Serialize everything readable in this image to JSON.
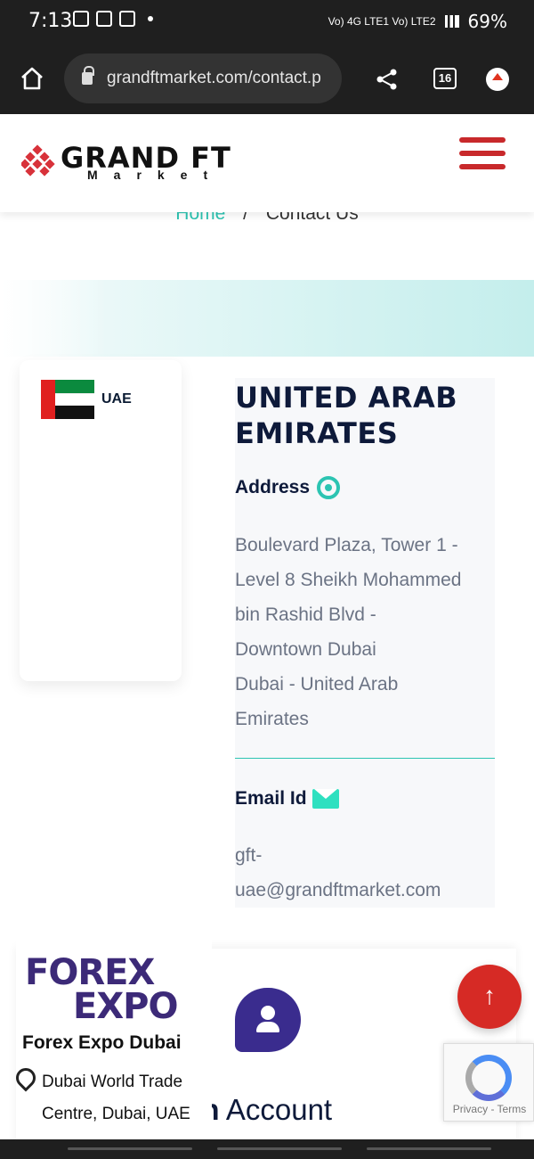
{
  "status_bar": {
    "time": "7:13",
    "network": "Vo) 4G LTE1 Vo) LTE2",
    "battery": "69%"
  },
  "browser": {
    "url": "grandftmarket.com/contact.p",
    "tab_count": "16"
  },
  "site": {
    "logo_name": "GRAND FT",
    "logo_sub": "Market",
    "brand_color": "#c8292b"
  },
  "breadcrumb": {
    "home": "Home",
    "separator": "/",
    "current": "Contact Us"
  },
  "sidebar": {
    "country": "UAE"
  },
  "office": {
    "title": "UNITED ARAB EMIRATES",
    "address_label": "Address",
    "address_lines": [
      "Boulevard Plaza, Tower 1 -",
      "Level 8 Sheikh Mohammed",
      "bin Rashid Blvd -",
      "Downtown Dubai",
      "Dubai - United Arab",
      "Emirates"
    ],
    "email_label": "Email Id",
    "email_lines": [
      "gft-",
      "uae@grandftmarket.com"
    ],
    "accent_color": "#2cc4b2"
  },
  "promo": {
    "logo_line1": "FOREX",
    "logo_line2": "EXPO",
    "title": "Forex Expo Dubai",
    "address_lines": [
      "Dubai World Trade",
      "Centre, Dubai, UAE"
    ]
  },
  "open_account": {
    "bold_part": "en",
    "rest": " Account"
  },
  "scroll_top": "↑",
  "recaptcha": "Privacy - Terms"
}
